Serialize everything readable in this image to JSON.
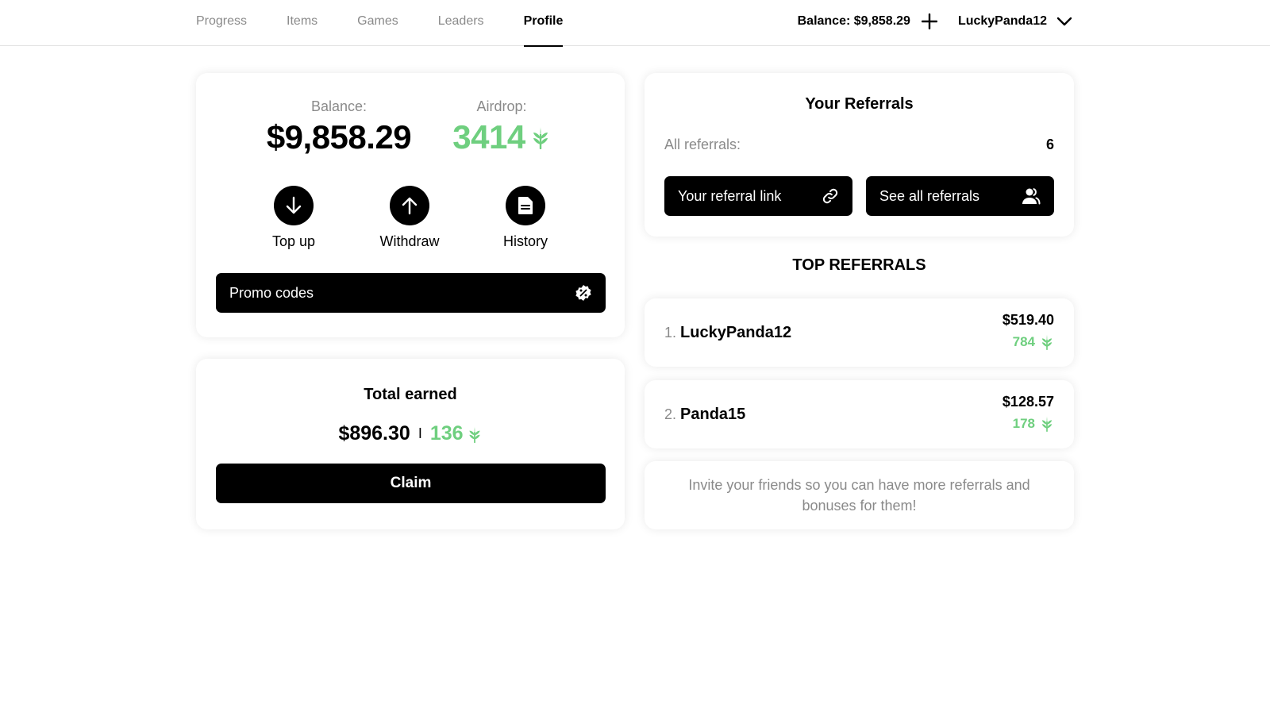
{
  "nav": {
    "tabs": [
      {
        "label": "Progress"
      },
      {
        "label": "Items"
      },
      {
        "label": "Games"
      },
      {
        "label": "Leaders"
      },
      {
        "label": "Profile"
      }
    ],
    "active_tab": "Profile",
    "balance_text": "Balance: $9,858.29",
    "username": "LuckyPanda12"
  },
  "wallet": {
    "balance_label": "Balance:",
    "balance_value": "$9,858.29",
    "airdrop_label": "Airdrop:",
    "airdrop_value": "3414",
    "actions": {
      "top_up": "Top up",
      "withdraw": "Withdraw",
      "history": "History"
    },
    "promo_label": "Promo codes"
  },
  "earned": {
    "title": "Total earned",
    "usd": "$896.30",
    "separator": "I",
    "airdrop": "136",
    "claim_label": "Claim"
  },
  "referrals": {
    "title": "Your Referrals",
    "all_label": "All referrals:",
    "all_count": "6",
    "link_label": "Your referral link",
    "see_all_label": "See all referrals"
  },
  "top_referrals": {
    "title": "TOP REFERRALS",
    "items": [
      {
        "rank": "1.",
        "name": "LuckyPanda12",
        "usd": "$519.40",
        "airdrop": "784"
      },
      {
        "rank": "2.",
        "name": "Panda15",
        "usd": "$128.57",
        "airdrop": "178"
      }
    ],
    "invite_text": "Invite your friends so you can have more referrals and bonuses for them!"
  },
  "colors": {
    "accent_green": "#6fcf7f",
    "muted_gray": "#8a8a8a",
    "button_black": "#000000"
  },
  "icons": [
    "plus-icon",
    "chevron-down-icon",
    "arrow-down-icon",
    "arrow-up-icon",
    "document-icon",
    "percent-badge-icon",
    "link-icon",
    "users-icon",
    "sprout-icon"
  ]
}
